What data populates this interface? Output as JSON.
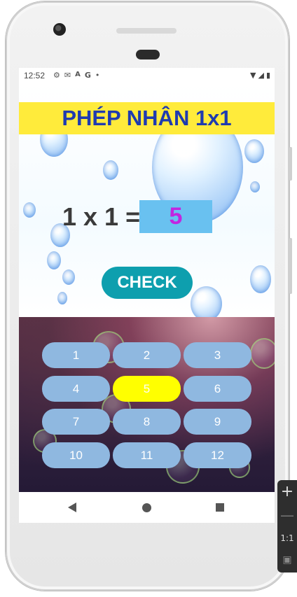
{
  "status_bar": {
    "time": "12:52",
    "icons": [
      "gear-icon",
      "mail-icon",
      "a-icon",
      "g-icon",
      "dot-icon"
    ],
    "right_icons": [
      "wifi-icon",
      "signal-icon",
      "battery-icon"
    ]
  },
  "quiz": {
    "title": "PHÉP NHÂN 1x1",
    "equation": "1 x 1 =",
    "answer": "5",
    "check_label": "CHECK"
  },
  "keypad": {
    "keys": [
      "1",
      "2",
      "3",
      "4",
      "5",
      "6",
      "7",
      "8",
      "9",
      "10",
      "11",
      "12"
    ],
    "selected": "5"
  },
  "nav": {
    "back": "back-icon",
    "home": "home-icon",
    "recent": "recent-apps-icon"
  },
  "emulator_toolbar": {
    "zoom_label": "1:1"
  },
  "colors": {
    "title_bg": "#ffeb3b",
    "title_text": "#1f3bb0",
    "answer_bg": "#69c1f0",
    "answer_text": "#c226e0",
    "check_bg": "#0e9fae",
    "key_bg": "#8fb8e0",
    "key_selected_bg": "#ffff00"
  }
}
